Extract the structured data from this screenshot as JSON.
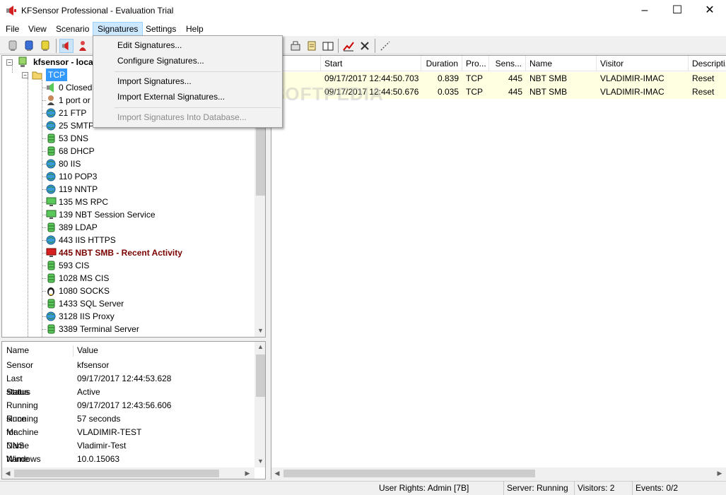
{
  "window": {
    "title": "KFSensor Professional - Evaluation Trial",
    "minimize": "–",
    "maximize": "☐",
    "close": "✕"
  },
  "menu": {
    "file": "File",
    "view": "View",
    "scenario": "Scenario",
    "signatures": "Signatures",
    "settings": "Settings",
    "help": "Help"
  },
  "signatures_menu": {
    "edit": "Edit Signatures...",
    "configure": "Configure Signatures...",
    "import": "Import Signatures...",
    "import_external": "Import External Signatures...",
    "import_db": "Import Signatures Into Database..."
  },
  "tree": {
    "root": "kfsensor - local",
    "tcp": "TCP",
    "items": [
      {
        "port": "0",
        "name": "Closed"
      },
      {
        "port": "1",
        "name": "port or"
      },
      {
        "port": "21",
        "name": "FTP"
      },
      {
        "port": "25",
        "name": "SMTP"
      },
      {
        "port": "53",
        "name": "DNS"
      },
      {
        "port": "68",
        "name": "DHCP"
      },
      {
        "port": "80",
        "name": "IIS"
      },
      {
        "port": "110",
        "name": "POP3"
      },
      {
        "port": "119",
        "name": "NNTP"
      },
      {
        "port": "135",
        "name": "MS RPC"
      },
      {
        "port": "139",
        "name": "NBT Session Service"
      },
      {
        "port": "389",
        "name": "LDAP"
      },
      {
        "port": "443",
        "name": "IIS HTTPS"
      },
      {
        "port": "445",
        "name": "NBT SMB  - Recent Activity"
      },
      {
        "port": "593",
        "name": "CIS"
      },
      {
        "port": "1028",
        "name": "MS CIS"
      },
      {
        "port": "1080",
        "name": "SOCKS"
      },
      {
        "port": "1433",
        "name": "SQL Server"
      },
      {
        "port": "3128",
        "name": "IIS Proxy"
      },
      {
        "port": "3389",
        "name": "Terminal Server"
      }
    ]
  },
  "props": {
    "header_name": "Name",
    "header_value": "Value",
    "rows": [
      {
        "name": "Sensor",
        "value": "kfsensor"
      },
      {
        "name": "Last status",
        "value": "09/17/2017 12:44:53.628"
      },
      {
        "name": "Status",
        "value": "Active"
      },
      {
        "name": "Running since",
        "value": "09/17/2017 12:43:56.606"
      },
      {
        "name": "Running for",
        "value": "57 seconds"
      },
      {
        "name": "Machine Name",
        "value": "VLADIMIR-TEST"
      },
      {
        "name": "DNS Name",
        "value": "Vladimir-Test"
      },
      {
        "name": "Windows version",
        "value": "10.0.15063"
      }
    ]
  },
  "grid": {
    "headers": [
      "Start",
      "Duration",
      "Pro...",
      "Sens...",
      "Name",
      "Visitor",
      "Descripti..."
    ],
    "rows": [
      {
        "id": "4",
        "start": "09/17/2017 12:44:50.703",
        "duration": "0.839",
        "proto": "TCP",
        "sensor": "445",
        "name": "NBT SMB",
        "visitor": "VLADIMIR-IMAC",
        "desc": "Reset"
      },
      {
        "id": "3",
        "start": "09/17/2017 12:44:50.676",
        "duration": "0.035",
        "proto": "TCP",
        "sensor": "445",
        "name": "NBT SMB",
        "visitor": "VLADIMIR-IMAC",
        "desc": "Reset"
      }
    ]
  },
  "status": {
    "rights": "User Rights: Admin [7B]",
    "server": "Server: Running",
    "visitors": "Visitors: 2",
    "events": "Events: 0/2"
  },
  "watermark": "SOFTPEDIA",
  "colors": {
    "highlight_row": "#ffffe1",
    "menu_active": "#cce8ff",
    "tcp_selected": "#3399ff"
  }
}
